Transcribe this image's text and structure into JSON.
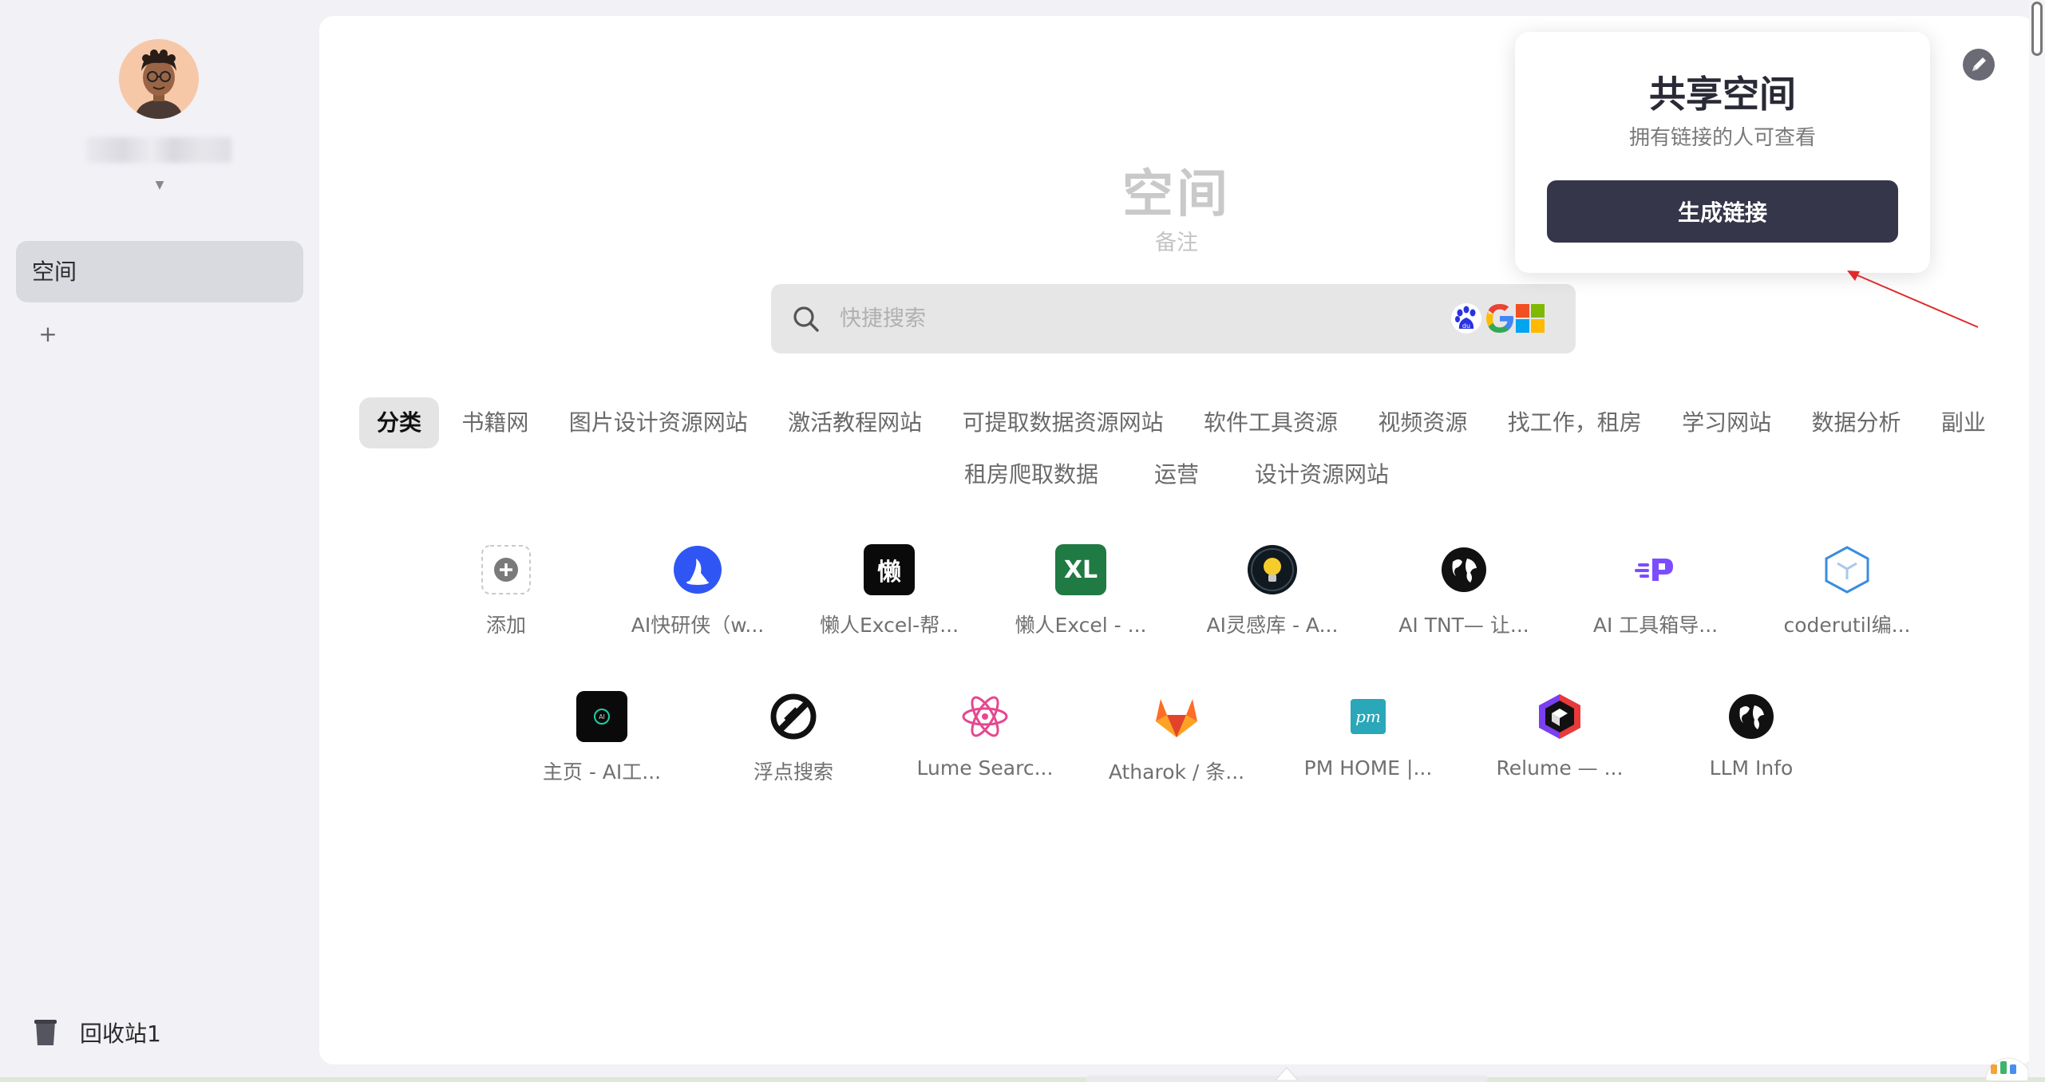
{
  "sidebar": {
    "space_label": "空间",
    "add_label": "+",
    "trash_label": "回收站1"
  },
  "main": {
    "title": "空间",
    "note": "备注",
    "search": {
      "placeholder": "快捷搜索"
    },
    "tabs_row1": [
      {
        "label": "分类",
        "active": true
      },
      {
        "label": "书籍网"
      },
      {
        "label": "图片设计资源网站"
      },
      {
        "label": "激活教程网站"
      },
      {
        "label": "可提取数据资源网站"
      },
      {
        "label": "软件工具资源"
      },
      {
        "label": "视频资源"
      },
      {
        "label": "找工作，租房"
      },
      {
        "label": "学习网站"
      },
      {
        "label": "数据分析"
      },
      {
        "label": "副业"
      }
    ],
    "tabs_row2": [
      {
        "label": "租房爬取数据"
      },
      {
        "label": "运营"
      },
      {
        "label": "设计资源网站"
      }
    ],
    "apps_row1": [
      {
        "label": "添加",
        "icon": "add-icon"
      },
      {
        "label": "AI快研侠（w...",
        "icon": "ai-kuaiyanxia-icon"
      },
      {
        "label": "懒人Excel-帮...",
        "icon": "lanren-icon",
        "glyph": "懒"
      },
      {
        "label": "懒人Excel - ...",
        "icon": "excel-xl-icon",
        "glyph": "XL"
      },
      {
        "label": "AI灵感库 - A...",
        "icon": "lightbulb-icon"
      },
      {
        "label": "AI TNT— 让...",
        "icon": "globe-icon"
      },
      {
        "label": "AI 工具箱导...",
        "icon": "ai-toolbox-icon"
      },
      {
        "label": "coderutil编...",
        "icon": "coderutil-cube-icon"
      }
    ],
    "apps_row2": [
      {
        "label": "主页 - AI工...",
        "icon": "ai-tool-black-icon"
      },
      {
        "label": "浮点搜索",
        "icon": "fudian-slash-icon"
      },
      {
        "label": "Lume Searc...",
        "icon": "atom-icon"
      },
      {
        "label": "Atharok / 条...",
        "icon": "gitlab-icon"
      },
      {
        "label": "PM HOME |...",
        "icon": "pm-icon",
        "glyph": "pm"
      },
      {
        "label": "Relume — ...",
        "icon": "relume-cube-icon"
      },
      {
        "label": "LLM Info",
        "icon": "globe-icon"
      }
    ]
  },
  "share_popup": {
    "title": "共享空间",
    "subtitle": "拥有链接的人可查看",
    "button": "生成链接"
  },
  "colors": {
    "popup_button": "#36364a",
    "excel_green": "#1f7a44",
    "ai_blue": "#2f56f5",
    "gitlab_orange": "#e2432a",
    "atom_pink": "#e5488f",
    "arrow_red": "#e02a2a"
  }
}
